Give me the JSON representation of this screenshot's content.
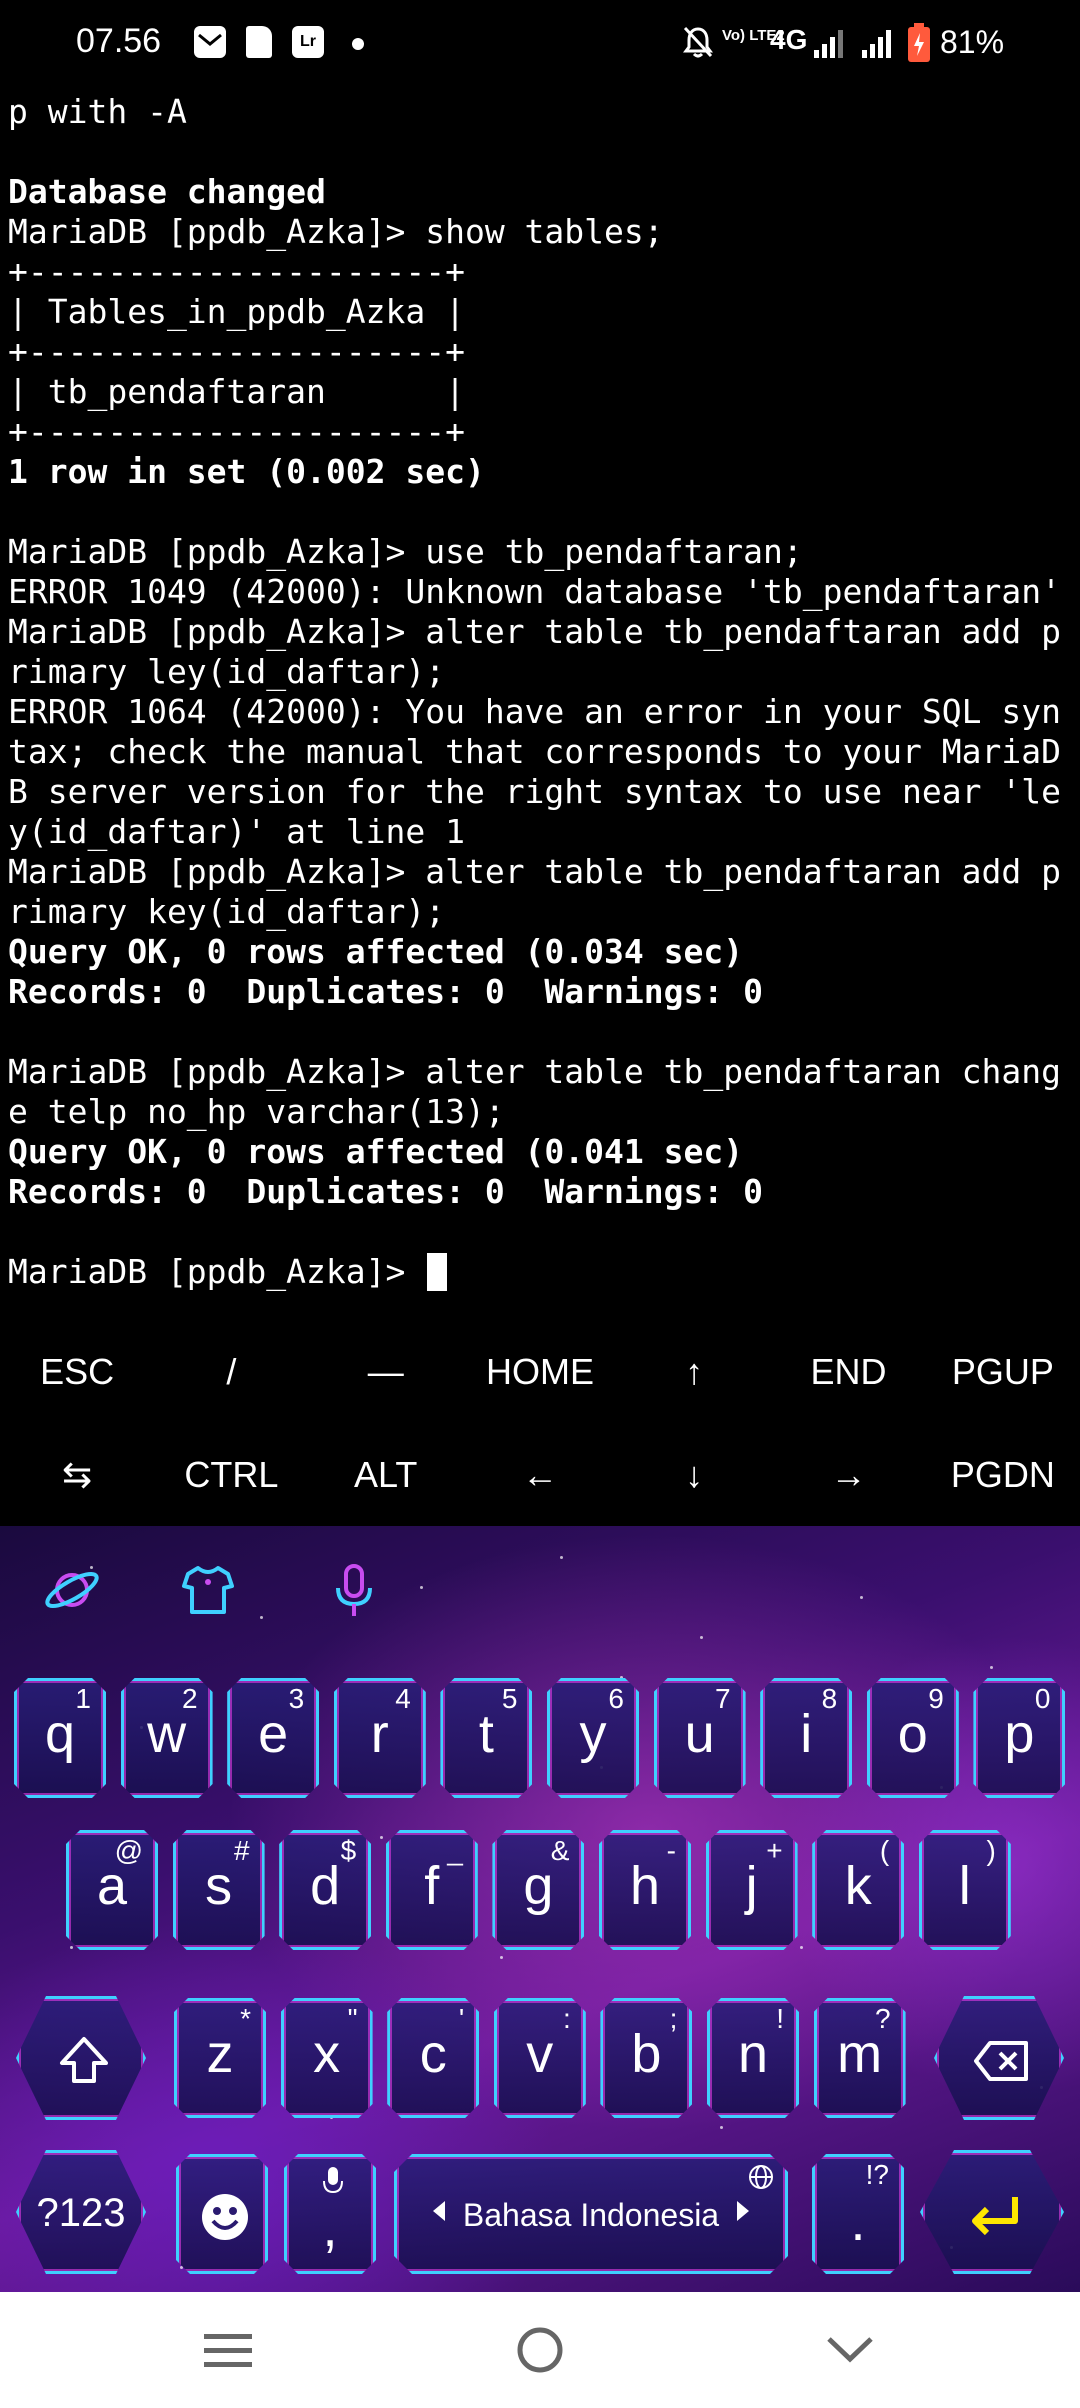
{
  "status_bar": {
    "time": "07.56",
    "notification_icons": [
      "gmail-icon",
      "sd-card-icon",
      "lightroom-icon"
    ],
    "lightroom_label": "Lr",
    "network_type": "4G",
    "volte_label": "Vo) LTE2",
    "battery_percent": "81%"
  },
  "terminal": {
    "lines": [
      {
        "text": "p with -A",
        "bold": false
      },
      {
        "text": "",
        "bold": false
      },
      {
        "text": "Database changed",
        "bold": true
      },
      {
        "text": "MariaDB [ppdb_Azka]> show tables;",
        "bold": false
      },
      {
        "text": "+---------------------+",
        "bold": false
      },
      {
        "text": "| Tables_in_ppdb_Azka |",
        "bold": false
      },
      {
        "text": "+---------------------+",
        "bold": false
      },
      {
        "text": "| tb_pendaftaran      |",
        "bold": false
      },
      {
        "text": "+---------------------+",
        "bold": false
      },
      {
        "text": "1 row in set (0.002 sec)",
        "bold": true
      },
      {
        "text": "",
        "bold": false
      },
      {
        "text": "MariaDB [ppdb_Azka]> use tb_pendaftaran;",
        "bold": false
      },
      {
        "text": "ERROR 1049 (42000): Unknown database 'tb_pendaftaran'",
        "bold": false
      },
      {
        "text": "MariaDB [ppdb_Azka]> alter table tb_pendaftaran add p",
        "bold": false
      },
      {
        "text": "rimary ley(id_daftar);",
        "bold": false
      },
      {
        "text": "ERROR 1064 (42000): You have an error in your SQL syn",
        "bold": false
      },
      {
        "text": "tax; check the manual that corresponds to your MariaD",
        "bold": false
      },
      {
        "text": "B server version for the right syntax to use near 'le",
        "bold": false
      },
      {
        "text": "y(id_daftar)' at line 1",
        "bold": false
      },
      {
        "text": "MariaDB [ppdb_Azka]> alter table tb_pendaftaran add p",
        "bold": false
      },
      {
        "text": "rimary key(id_daftar);",
        "bold": false
      },
      {
        "text": "Query OK, 0 rows affected (0.034 sec)",
        "bold": true
      },
      {
        "text": "Records: 0  Duplicates: 0  Warnings: 0",
        "bold": true
      },
      {
        "text": "",
        "bold": false
      },
      {
        "text": "MariaDB [ppdb_Azka]> alter table tb_pendaftaran chang",
        "bold": false
      },
      {
        "text": "e telp no_hp varchar(13);",
        "bold": false
      },
      {
        "text": "Query OK, 0 rows affected (0.041 sec)",
        "bold": true
      },
      {
        "text": "Records: 0  Duplicates: 0  Warnings: 0",
        "bold": true
      },
      {
        "text": "",
        "bold": false
      }
    ],
    "prompt": "MariaDB [ppdb_Azka]> "
  },
  "extra_keys": {
    "row1": [
      "ESC",
      "/",
      "—",
      "HOME",
      "↑",
      "END",
      "PGUP"
    ],
    "row2": [
      "⇆",
      "CTRL",
      "ALT",
      "←",
      "↓",
      "→",
      "PGDN"
    ]
  },
  "keyboard": {
    "toolbar_icons": [
      "planet-icon",
      "shirt-icon",
      "microphone-icon"
    ],
    "accent_color": "#3fd0ff",
    "row1": [
      {
        "key": "q",
        "hint": "1"
      },
      {
        "key": "w",
        "hint": "2"
      },
      {
        "key": "e",
        "hint": "3"
      },
      {
        "key": "r",
        "hint": "4"
      },
      {
        "key": "t",
        "hint": "5"
      },
      {
        "key": "y",
        "hint": "6"
      },
      {
        "key": "u",
        "hint": "7"
      },
      {
        "key": "i",
        "hint": "8"
      },
      {
        "key": "o",
        "hint": "9"
      },
      {
        "key": "p",
        "hint": "0"
      }
    ],
    "row2": [
      {
        "key": "a",
        "hint": "@"
      },
      {
        "key": "s",
        "hint": "#"
      },
      {
        "key": "d",
        "hint": "$"
      },
      {
        "key": "f",
        "hint": "_"
      },
      {
        "key": "g",
        "hint": "&"
      },
      {
        "key": "h",
        "hint": "-"
      },
      {
        "key": "j",
        "hint": "+"
      },
      {
        "key": "k",
        "hint": "("
      },
      {
        "key": "l",
        "hint": ")"
      }
    ],
    "row3": [
      {
        "key": "z",
        "hint": "*"
      },
      {
        "key": "x",
        "hint": "\""
      },
      {
        "key": "c",
        "hint": "'"
      },
      {
        "key": "v",
        "hint": ":"
      },
      {
        "key": "b",
        "hint": ";"
      },
      {
        "key": "n",
        "hint": "!"
      },
      {
        "key": "m",
        "hint": "?"
      }
    ],
    "symbols_label": "?123",
    "comma_label": ",",
    "period_label": ".",
    "period_hint": "!?",
    "space_label": "Bahasa Indonesia"
  },
  "nav_bar": {
    "buttons": [
      "menu-icon",
      "home-icon",
      "back-icon"
    ]
  }
}
